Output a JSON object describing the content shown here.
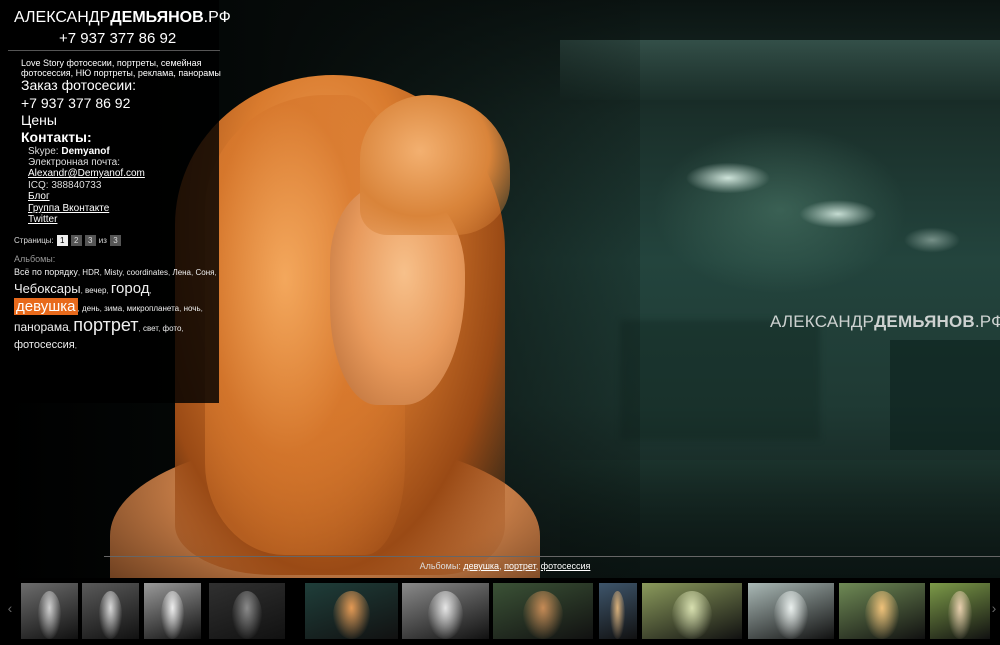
{
  "header": {
    "logo_light": "АЛЕКСАНДР",
    "logo_bold": "ДЕМЬЯНОВ",
    "logo_tld": ".РФ",
    "phone": "+7 937 377 86 92"
  },
  "sidebar": {
    "tagline": "Love Story фотосесии, портреты, семейная фотосессия, НЮ портреты, реклама, панорамы",
    "order_label": "Заказ фотосесии:",
    "order_phone": "+7 937 377 86 92",
    "prices": "Цены",
    "contacts_heading": "Контакты:",
    "skype_label": "Skype:",
    "skype_value": "Demyanof",
    "email_label": "Электронная почта:",
    "email": "Alexandr@Demyanof.com",
    "icq": "ICQ: 388840733",
    "blog": "Блог",
    "vk": "Группа Вконтакте",
    "twitter": "Twitter"
  },
  "pagination": {
    "label": "Страницы:",
    "pages": [
      "1",
      "2",
      "3"
    ],
    "of_label": "из",
    "total": "3"
  },
  "albums": {
    "label": "Альбомы:",
    "tags": [
      {
        "text": "Всё по порядку",
        "size": 9
      },
      {
        "text": "HDR",
        "size": 8
      },
      {
        "text": "Misty",
        "size": 8
      },
      {
        "text": "coordinates",
        "size": 8
      },
      {
        "text": "Лена",
        "size": 8
      },
      {
        "text": "Соня",
        "size": 8
      },
      {
        "text": "Чебоксары",
        "size": 13
      },
      {
        "text": "вечер",
        "size": 8
      },
      {
        "text": "город",
        "size": 15
      },
      {
        "text": "девушка",
        "size": 15,
        "selected": true
      },
      {
        "text": "день",
        "size": 8
      },
      {
        "text": "зима",
        "size": 8
      },
      {
        "text": "микропланета",
        "size": 8
      },
      {
        "text": "ночь",
        "size": 8
      },
      {
        "text": "панорама",
        "size": 12
      },
      {
        "text": "портрет",
        "size": 18
      },
      {
        "text": "свет",
        "size": 8
      },
      {
        "text": "фото",
        "size": 8
      },
      {
        "text": "фотосессия",
        "size": 11
      }
    ]
  },
  "caption": {
    "label": "Альбомы:",
    "links": [
      "девушка",
      "портрет",
      "фотосессия"
    ]
  },
  "watermark": {
    "light": "АЛЕКСАНДР",
    "bold": "ДЕМЬЯНОВ",
    "tld": ".РФ"
  },
  "thumbnails": [
    {
      "name": "thumb-1",
      "bg": "#6d6d6d",
      "accent": "#cfcfcf"
    },
    {
      "name": "thumb-2",
      "bg": "#5a5a5a",
      "accent": "#d8d8d8"
    },
    {
      "name": "thumb-3",
      "bg": "#9a9a9a",
      "accent": "#eeeeee"
    },
    {
      "name": "thumb-4",
      "bg": "#303030",
      "accent": "#8a8a8a"
    },
    {
      "name": "thumb-5",
      "bg": "#1f3e3a",
      "accent": "#e49a55"
    },
    {
      "name": "thumb-6",
      "bg": "#8a8a8a",
      "accent": "#e6e6e6"
    },
    {
      "name": "thumb-7",
      "bg": "#3b5236",
      "accent": "#c68b56"
    },
    {
      "name": "thumb-8",
      "bg": "#3e556b",
      "accent": "#d9b07a"
    },
    {
      "name": "thumb-9",
      "bg": "#8b9a5c",
      "accent": "#d8e0b0"
    },
    {
      "name": "thumb-10",
      "bg": "#aab9b6",
      "accent": "#eaf0ee"
    },
    {
      "name": "thumb-11",
      "bg": "#6f8a55",
      "accent": "#f0c27a"
    },
    {
      "name": "thumb-12",
      "bg": "#7c9a48",
      "accent": "#e8cfae"
    },
    {
      "name": "thumb-13",
      "bg": "#3a3a2e",
      "accent": "#e0b58c"
    }
  ],
  "nav": {
    "prev": "‹",
    "next": "›"
  }
}
